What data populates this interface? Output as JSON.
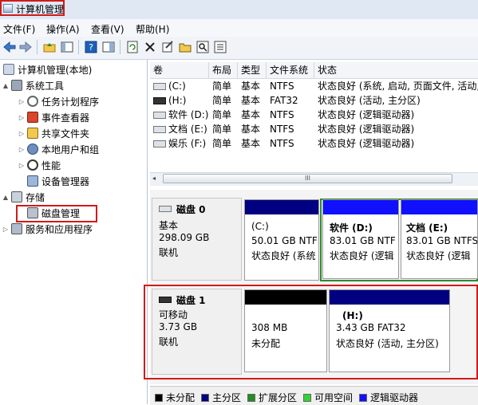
{
  "window": {
    "title": "计算机管理"
  },
  "menu": {
    "items": [
      "文件(F)",
      "操作(A)",
      "查看(V)",
      "帮助(H)"
    ]
  },
  "toolbar": {
    "buttons": [
      "back-icon",
      "forward-icon",
      "up-folder-icon",
      "show-tree-icon",
      "help-icon",
      "properties-pane-icon",
      "refresh-icon",
      "delete-icon",
      "properties-icon",
      "open-folder-icon",
      "search-icon",
      "settings-icon"
    ]
  },
  "tree": {
    "root": "计算机管理(本地)",
    "system_tools": "系统工具",
    "task_scheduler": "任务计划程序",
    "event_viewer": "事件查看器",
    "shared_folders": "共享文件夹",
    "local_users": "本地用户和组",
    "performance": "性能",
    "device_manager": "设备管理器",
    "storage": "存储",
    "disk_management": "磁盘管理",
    "services": "服务和应用程序"
  },
  "volumes": {
    "headers": [
      "卷",
      "布局",
      "类型",
      "文件系统",
      "状态"
    ],
    "rows": [
      [
        "(C:)",
        "简单",
        "基本",
        "NTFS",
        "状态良好 (系统, 启动, 页面文件, 活动,"
      ],
      [
        "(H:)",
        "简单",
        "基本",
        "FAT32",
        "状态良好 (活动, 主分区)"
      ],
      [
        "软件 (D:)",
        "简单",
        "基本",
        "NTFS",
        "状态良好 (逻辑驱动器)"
      ],
      [
        "文档 (E:)",
        "简单",
        "基本",
        "NTFS",
        "状态良好 (逻辑驱动器)"
      ],
      [
        "娱乐 (F:)",
        "简单",
        "基本",
        "NTFS",
        "状态良好 (逻辑驱动器)"
      ]
    ],
    "scroll_grip": "III"
  },
  "disk0": {
    "name": "磁盘 0",
    "type": "基本",
    "size": "298.09 GB",
    "status": "联机",
    "partitions": [
      {
        "label": "(C:)",
        "size": "50.01 GB NTF",
        "status": "状态良好 (系统"
      },
      {
        "label": "软件  (D:)",
        "size": "83.01 GB NTF",
        "status": "状态良好 (逻辑"
      },
      {
        "label": "文档  (E:)",
        "size": "83.01 GB NTFS",
        "status": "状态良好 (逻辑"
      }
    ]
  },
  "disk1": {
    "name": "磁盘 1",
    "type": "可移动",
    "size": "3.73 GB",
    "status": "联机",
    "partitions": [
      {
        "label": "",
        "size": "308 MB",
        "status": "未分配"
      },
      {
        "label": "(H:)",
        "size": "3.43 GB FAT32",
        "status": "状态良好 (活动, 主分区)"
      }
    ]
  },
  "legend": [
    {
      "label": "未分配",
      "color": "#000000"
    },
    {
      "label": "主分区",
      "color": "#000080"
    },
    {
      "label": "扩展分区",
      "color": "#1f8f1f"
    },
    {
      "label": "可用空间",
      "color": "#32d232"
    },
    {
      "label": "逻辑驱动器",
      "color": "#1010ff"
    }
  ],
  "colors": {
    "primary": "#000080",
    "logical": "#1010ff",
    "unallocated": "#000000",
    "highlight": "#d11a1a",
    "extended": "#2e8b2e"
  }
}
